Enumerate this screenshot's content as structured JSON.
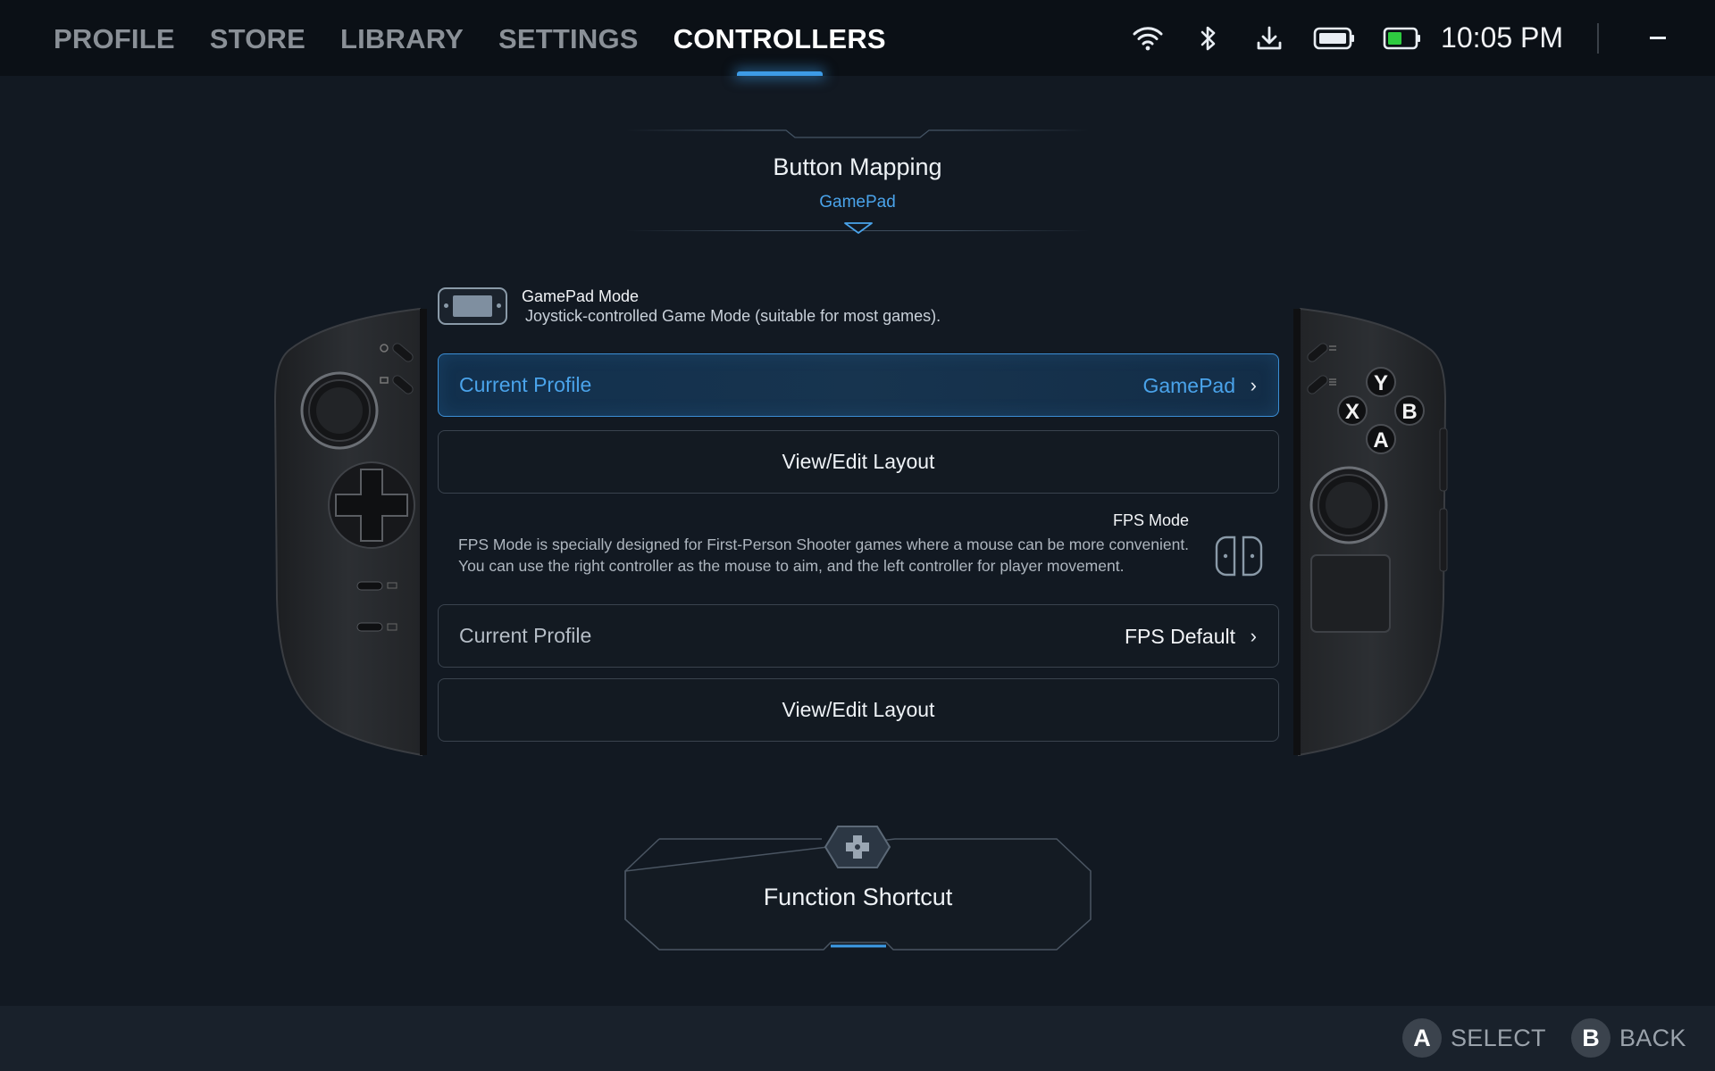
{
  "tabs": [
    {
      "label": "PROFILE",
      "active": false
    },
    {
      "label": "STORE",
      "active": false
    },
    {
      "label": "LIBRARY",
      "active": false
    },
    {
      "label": "SETTINGS",
      "active": false
    },
    {
      "label": "CONTROLLERS",
      "active": true
    }
  ],
  "status": {
    "icons": [
      "wifi-icon",
      "bluetooth-icon",
      "download-icon",
      "controller-battery-icon",
      "battery-icon"
    ],
    "time": "10:05 PM",
    "battery_color": "#2ecc40"
  },
  "header": {
    "title": "Button Mapping",
    "subtitle": "GamePad"
  },
  "gamepad_mode": {
    "title": "GamePad Mode",
    "description": "Joystick-controlled Game Mode (suitable for most games).",
    "current_profile_label": "Current Profile",
    "current_profile_value": "GamePad",
    "edit_layout_label": "View/Edit Layout"
  },
  "fps_mode": {
    "title": "FPS Mode",
    "description": "FPS Mode is specially designed for First-Person Shooter games where a mouse can be more convenient. You can use the right controller as the mouse to aim, and the left controller for player movement.",
    "current_profile_label": "Current Profile",
    "current_profile_value": "FPS Default",
    "edit_layout_label": "View/Edit Layout"
  },
  "function_shortcut": {
    "label": "Function Shortcut"
  },
  "right_controller": {
    "buttons": [
      "Y",
      "X",
      "B",
      "A"
    ]
  },
  "footer": {
    "select_key": "A",
    "select_label": "SELECT",
    "back_key": "B",
    "back_label": "BACK"
  },
  "colors": {
    "accent": "#3d9be6",
    "background": "#121922",
    "topbar": "#0b1016"
  }
}
